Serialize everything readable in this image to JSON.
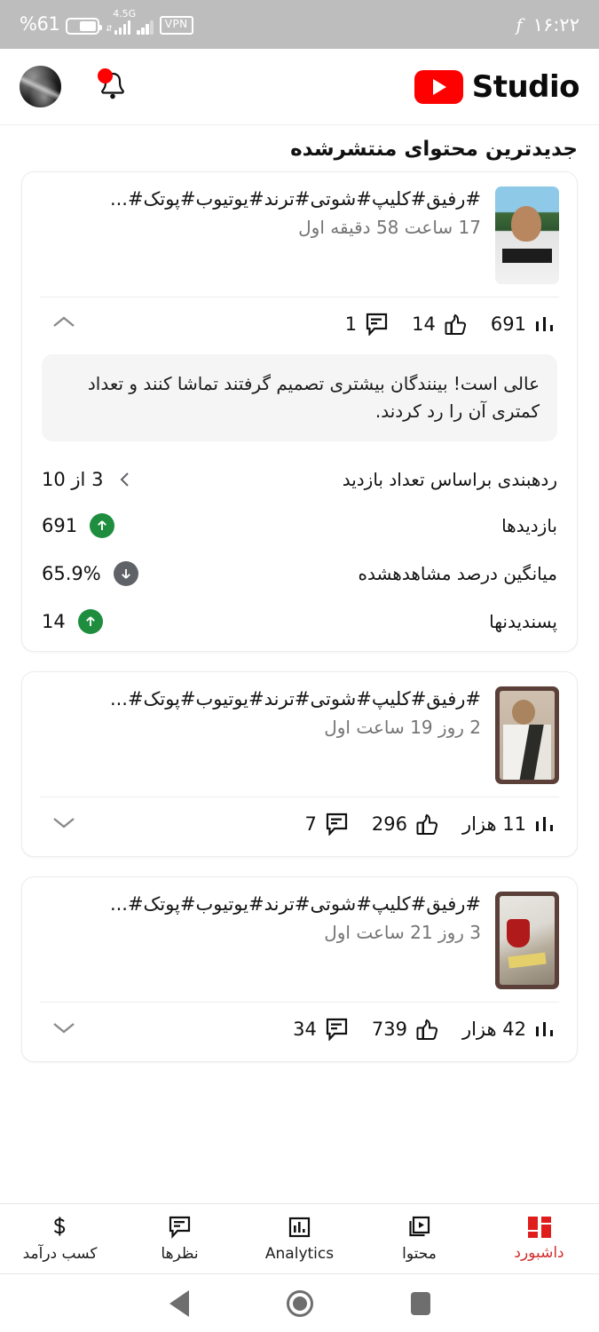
{
  "status_bar": {
    "battery_percent": "%61",
    "network_tag": "4.5G",
    "vpn_label": "VPN",
    "alarm_glyph": "f",
    "time": "۱۶:۲۲"
  },
  "app_bar": {
    "brand_word": "Studio",
    "avatar_name": "channel-avatar",
    "bell_has_unread": true
  },
  "main": {
    "section_title": "جدیدترین محتوای منتشرشده",
    "cards": [
      {
        "title": "#رفیق#کلیپ#شوتی#ترند#یوتیوب#پوتک#...",
        "subtitle": "17 ساعت 58 دقیقه اول",
        "expanded": true,
        "stats": {
          "views": "691",
          "likes": "14",
          "comments": "1"
        },
        "insight": "عالی است! بینندگان بیشتری تصمیم گرفتند تماشا کنند و تعداد کمتری آن را رد کردند.",
        "metrics": [
          {
            "label": "ردهبندی براساس تعداد بازدید",
            "value": "3 از 10",
            "indicator": "chevron"
          },
          {
            "label": "بازدیدها",
            "value": "691",
            "indicator": "up"
          },
          {
            "label": "میانگین درصد مشاهدهشده",
            "value": "65.9%",
            "indicator": "down"
          },
          {
            "label": "پسندیدنها",
            "value": "14",
            "indicator": "up"
          }
        ]
      },
      {
        "title": "#رفیق#کلیپ#شوتی#ترند#یوتیوب#پوتک#...",
        "subtitle": "2 روز 19 ساعت اول",
        "expanded": false,
        "stats": {
          "views": "11 هزار",
          "likes": "296",
          "comments": "7"
        }
      },
      {
        "title": "#رفیق#کلیپ#شوتی#ترند#یوتیوب#پوتک#...",
        "subtitle": "3 روز 21 ساعت اول",
        "expanded": false,
        "stats": {
          "views": "42 هزار",
          "likes": "739",
          "comments": "34"
        }
      }
    ]
  },
  "bottom_nav": {
    "items": [
      {
        "label": "داشبورد",
        "icon": "dashboard-grid-icon",
        "active": true
      },
      {
        "label": "محتوا",
        "icon": "content-play-icon",
        "active": false
      },
      {
        "label": "Analytics",
        "icon": "analytics-bars-icon",
        "active": false
      },
      {
        "label": "نظرها",
        "icon": "comments-icon",
        "active": false
      },
      {
        "label": "کسب درآمد",
        "icon": "monetization-dollar-icon",
        "active": false
      }
    ],
    "active_color": "#d32f2f"
  },
  "system_nav": {
    "recents_label": "recents",
    "home_label": "home",
    "back_label": "back"
  },
  "colors": {
    "brand_red": "#ff0000",
    "accent_red": "#e01d1d",
    "positive_green": "#1e8e3e",
    "negative_gray": "#5f6368",
    "status_bar_bg": "#bdbdbd"
  }
}
